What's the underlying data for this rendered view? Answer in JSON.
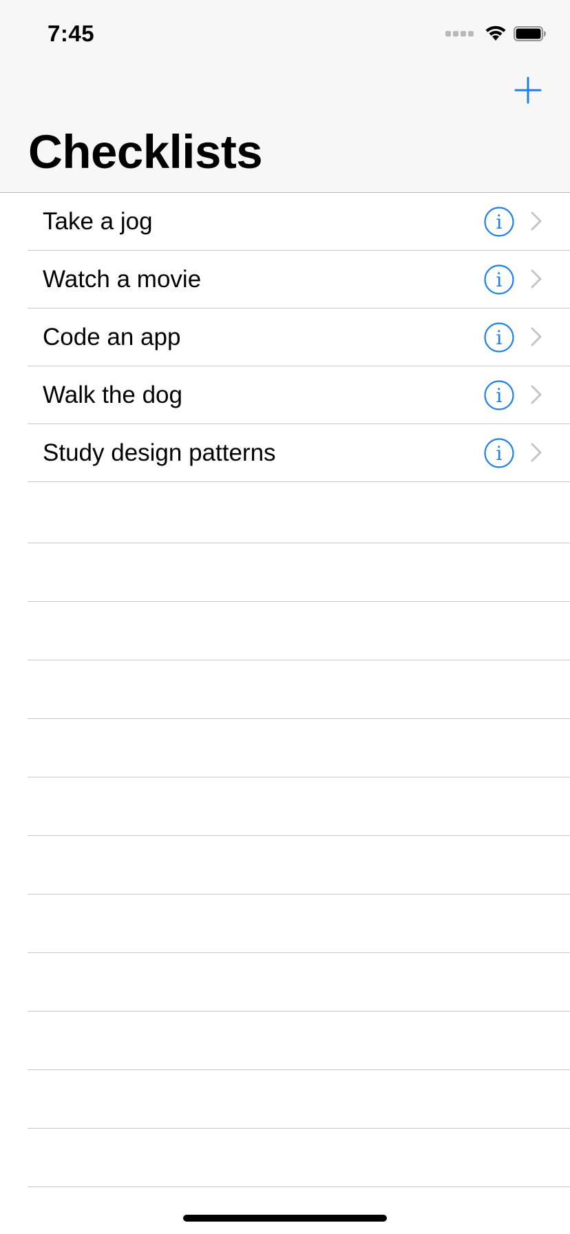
{
  "status_bar": {
    "time": "7:45",
    "signal_icon": "signal-dots-icon",
    "wifi_icon": "wifi-icon",
    "battery_icon": "battery-icon"
  },
  "nav": {
    "title": "Checklists",
    "add_icon": "plus-icon"
  },
  "checklists": [
    {
      "label": "Take a jog"
    },
    {
      "label": "Watch a movie"
    },
    {
      "label": "Code an app"
    },
    {
      "label": "Walk the dog"
    },
    {
      "label": "Study design patterns"
    }
  ],
  "colors": {
    "accent": "#1a7ff0",
    "chevron": "#c4c4c7",
    "separator": "#c8c7cc",
    "nav_background": "#f7f7f7"
  }
}
